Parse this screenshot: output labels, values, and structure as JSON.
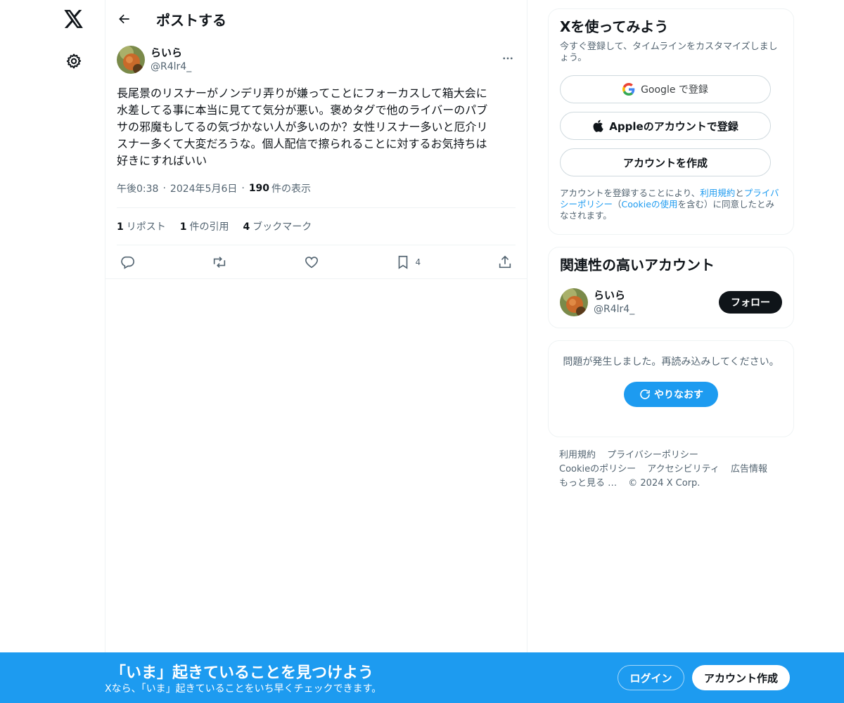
{
  "header": {
    "title": "ポストする"
  },
  "post": {
    "author_name": "らいら",
    "author_handle": "@R4lr4_",
    "text": "長尾景のリスナーがノンデリ弄りが嫌ってことにフォーカスして箱大会に\n水差してる事に本当に見てて気分が悪い。褒めタグで他のライバーのパブ\nサの邪魔もしてるの気づかない人が多いのか？女性リスナー多いと厄介リ\nスナー多くて大変だろうな。個人配信で擦られることに対するお気持ちは\n好きにすればいい",
    "time": "午後0:38",
    "date": "2024年5月6日",
    "views_count": "190",
    "views_label": "件の表示",
    "reposts_count": "1",
    "reposts_label": "リポスト",
    "quotes_count": "1",
    "quotes_label": "件の引用",
    "bookmarks_count": "4",
    "bookmarks_label": "ブックマーク",
    "bookmark_action_count": "4"
  },
  "signup_card": {
    "title": "Xを使ってみよう",
    "subtitle": "今すぐ登録して、タイムラインをカスタマイズしましょう。",
    "google_label": "Google で登録",
    "apple_label": "Appleのアカウントで登録",
    "create_label": "アカウントを作成",
    "legal_prefix": "アカウントを登録することにより、",
    "terms_link": "利用規約",
    "legal_and": "と",
    "privacy_link": "プライバシーポリシー",
    "legal_paren_open": "（",
    "cookie_link": "Cookieの使用",
    "legal_suffix": "を含む）に同意したとみなされます。"
  },
  "related_card": {
    "title": "関連性の高いアカウント",
    "name": "らいら",
    "handle": "@R4lr4_",
    "follow_label": "フォロー"
  },
  "error_card": {
    "message": "問題が発生しました。再読み込みしてください。",
    "retry_label": "やりなおす"
  },
  "footer": {
    "terms": "利用規約",
    "privacy": "プライバシーポリシー",
    "cookie": "Cookieのポリシー",
    "accessibility": "アクセシビリティ",
    "ads": "広告情報",
    "more": "もっと見る …",
    "copyright": "© 2024 X Corp."
  },
  "banner": {
    "title": "「いま」起きていることを見つけよう",
    "subtitle": "Xなら、「いま」起きていることをいち早くチェックできます。",
    "login_label": "ログイン",
    "signup_label": "アカウント作成"
  },
  "colors": {
    "accent": "#1d9bf0",
    "text": "#0f1419",
    "secondary": "#536471",
    "border": "#eff3f4"
  }
}
